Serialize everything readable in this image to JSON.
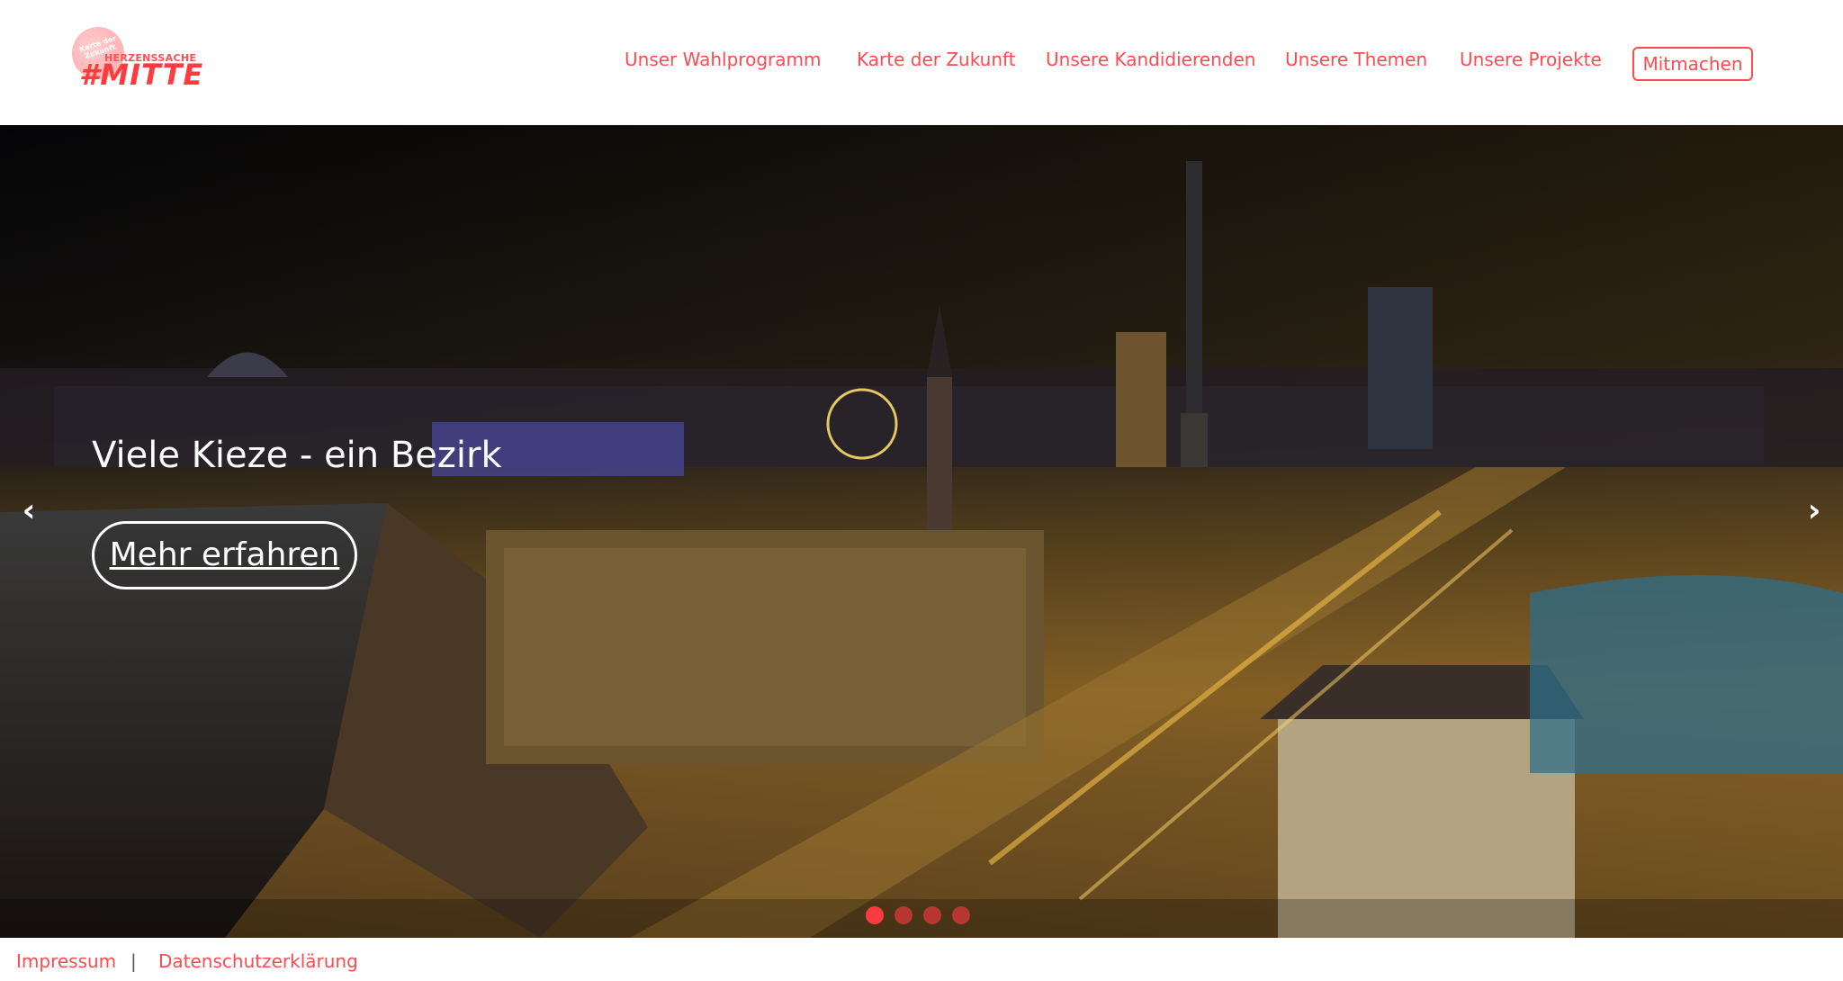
{
  "brand": {
    "logo_circle_text": "Karte der Zukunft",
    "logo_small": "HERZENSSACHE",
    "logo_big": "#MITTE",
    "accent_color": "#ff4a4f"
  },
  "nav": {
    "items": [
      {
        "label": "Unser Wahlprogramm"
      },
      {
        "label": "Karte der Zukunft"
      },
      {
        "label": "Unsere Kandidierenden"
      },
      {
        "label": "Unsere Themen"
      },
      {
        "label": "Unsere Projekte"
      }
    ],
    "cta_label": "Mitmachen"
  },
  "hero": {
    "title": "Viele Kieze - ein Bezirk",
    "button_label": "Mehr erfahren",
    "prev_arrow": "‹",
    "next_arrow": "›",
    "slide_count": 4,
    "active_slide": 1
  },
  "footer": {
    "impressum": "Impressum",
    "separator": "|",
    "datenschutz": "Datenschutzerklärung"
  }
}
